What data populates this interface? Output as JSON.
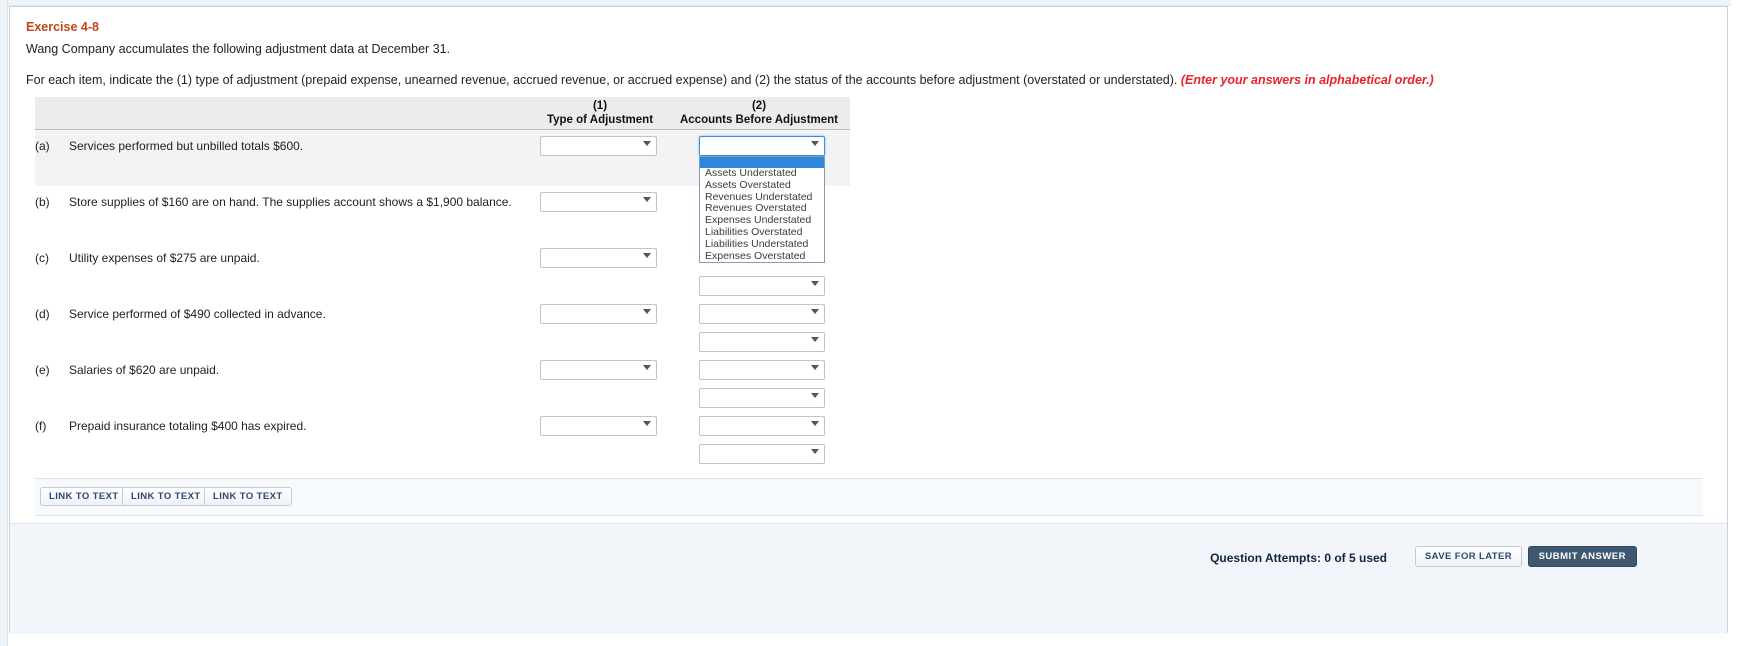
{
  "exercise": {
    "title": "Exercise 4-8",
    "intro": "Wang Company accumulates the following adjustment data at December 31.",
    "instruction_main": "For each item, indicate the (1) type of adjustment (prepaid expense, unearned revenue, accrued revenue, or accrued expense) and (2) the status of the accounts before adjustment (overstated or understated).",
    "instruction_note": "(Enter your answers in alphabetical order.)"
  },
  "table": {
    "headers": {
      "col1_number": "(1)",
      "col1_label": "Type of Adjustment",
      "col2_number": "(2)",
      "col2_label": "Accounts Before Adjustment"
    },
    "rows": [
      {
        "marker": "(a)",
        "description": "Services performed but unbilled totals $600.",
        "type_value": "",
        "accounts_value": ""
      },
      {
        "marker": "(b)",
        "description": "Store supplies of $160 are on hand. The supplies account shows a $1,900 balance.",
        "type_value": "",
        "accounts_value": ""
      },
      {
        "marker": "(c)",
        "description": "Utility expenses of $275 are unpaid.",
        "type_value": "",
        "accounts_value": ""
      },
      {
        "marker": "(d)",
        "description": "Service performed of $490 collected in advance.",
        "type_value": "",
        "accounts_value": ""
      },
      {
        "marker": "(e)",
        "description": "Salaries of $620 are unpaid.",
        "type_value": "",
        "accounts_value": ""
      },
      {
        "marker": "(f)",
        "description": "Prepaid insurance totaling $400 has expired.",
        "type_value": "",
        "accounts_value": ""
      }
    ]
  },
  "dropdown": {
    "open": true,
    "blank_option": "",
    "options": [
      "Assets Understated",
      "Assets Overstated",
      "Revenues Understated",
      "Revenues Overstated",
      "Expenses Understated",
      "Liabilities Overstated",
      "Liabilities Understated",
      "Expenses Overstated"
    ]
  },
  "footer": {
    "link_to_text_1": "LINK TO TEXT",
    "link_to_text_2": "LINK TO TEXT",
    "link_to_text_3": "LINK TO TEXT",
    "attempts": "Question Attempts: 0 of 5 used",
    "save_label": "SAVE FOR LATER",
    "submit_label": "SUBMIT ANSWER"
  },
  "colors": {
    "title": "#c0451b",
    "note": "#e8232a",
    "header_bg": "#ececec",
    "highlight": "#2f86dd",
    "submit_bg": "#3f5872"
  }
}
